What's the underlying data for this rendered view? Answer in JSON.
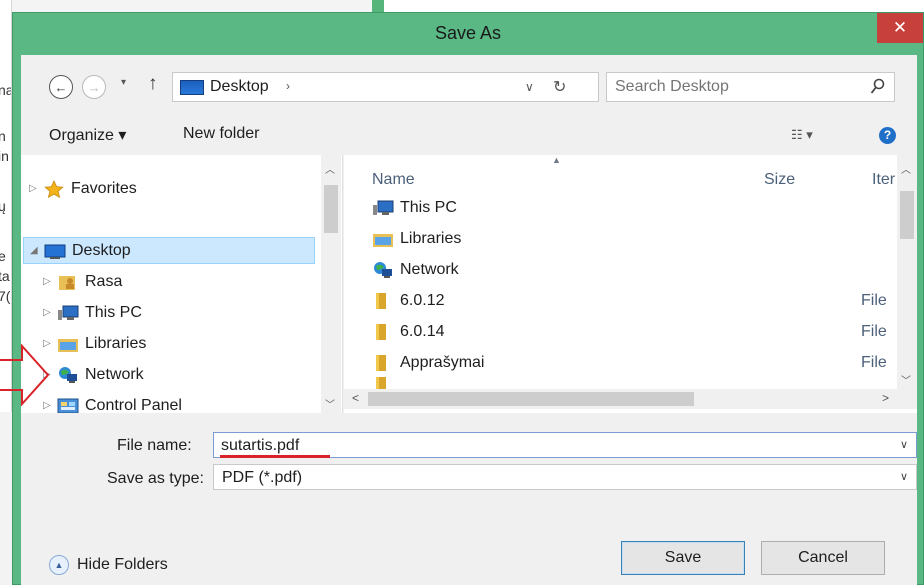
{
  "dialog": {
    "title": "Save As",
    "close_glyph": "✕"
  },
  "background": {
    "left_fragments": [
      "na",
      "n",
      "in",
      "ų",
      "e",
      "ta",
      "7("
    ]
  },
  "address": {
    "back_glyph": "←",
    "forward_glyph": "→",
    "dropdown_glyph": "▾",
    "up_glyph": "↑",
    "location": "Desktop",
    "separator_glyph": "›",
    "refresh_glyph": "↻",
    "address_dropdown_glyph": "∨"
  },
  "search": {
    "placeholder": "Search Desktop"
  },
  "toolbar": {
    "organize": "Organize ▾",
    "new_folder": "New folder",
    "view_glyph": "☷ ▾",
    "help_glyph": "?"
  },
  "navpane": {
    "items": [
      {
        "label": "Favorites",
        "icon": "star-icon"
      },
      {
        "label": "Desktop",
        "icon": "desktop-icon"
      },
      {
        "label": "Rasa",
        "icon": "user-folder-icon"
      },
      {
        "label": "This PC",
        "icon": "computer-icon"
      },
      {
        "label": "Libraries",
        "icon": "libraries-icon"
      },
      {
        "label": "Network",
        "icon": "network-icon"
      },
      {
        "label": "Control Panel",
        "icon": "control-panel-icon"
      }
    ]
  },
  "filelist": {
    "columns": {
      "name": "Name",
      "size": "Size",
      "type": "Iter"
    },
    "rows": [
      {
        "name": "This PC",
        "icon": "computer-icon",
        "type": ""
      },
      {
        "name": "Libraries",
        "icon": "libraries-icon",
        "type": ""
      },
      {
        "name": "Network",
        "icon": "network-icon",
        "type": ""
      },
      {
        "name": "6.0.12",
        "icon": "folder-icon",
        "type": "File"
      },
      {
        "name": "6.0.14",
        "icon": "folder-icon",
        "type": "File"
      },
      {
        "name": "Apprašymai",
        "icon": "folder-icon",
        "type": "File"
      }
    ]
  },
  "form": {
    "file_name_label": "File name:",
    "file_name_value": "sutartis.pdf",
    "save_as_type_label": "Save as type:",
    "save_as_type_value": "PDF (*.pdf)"
  },
  "footer": {
    "hide_folders": "Hide Folders",
    "save": "Save",
    "cancel": "Cancel"
  },
  "colors": {
    "titlebar": "#59b884",
    "close": "#c7403b",
    "selection": "#cce8ff",
    "annotation": "#d9232a"
  }
}
